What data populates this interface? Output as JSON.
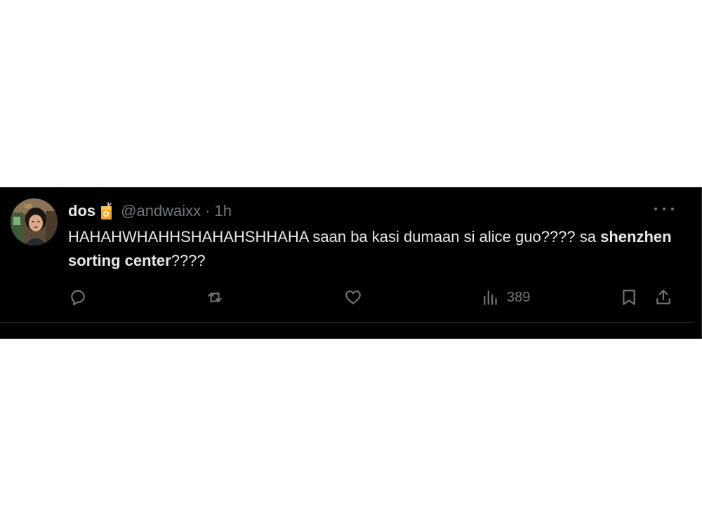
{
  "tweet": {
    "display_name": "dos",
    "name_emoji": "juice-box-emoji",
    "handle": "@andwaixx",
    "separator": "·",
    "time": "1h",
    "text_part1": "HAHAHWHAHHSHAHAHSHHAHA saan ba kasi dumaan si alice guo???? sa ",
    "text_bold": "shenzhen sorting center",
    "text_part2": "????"
  },
  "actions": {
    "reply_icon": "reply-icon",
    "retweet_icon": "retweet-icon",
    "like_icon": "like-icon",
    "views_icon": "views-icon",
    "views_count": "389",
    "bookmark_icon": "bookmark-icon",
    "share_icon": "share-icon"
  },
  "colors": {
    "background": "#000000",
    "text": "#e7e9ea",
    "secondary": "#71767b",
    "border": "#2f3336"
  }
}
